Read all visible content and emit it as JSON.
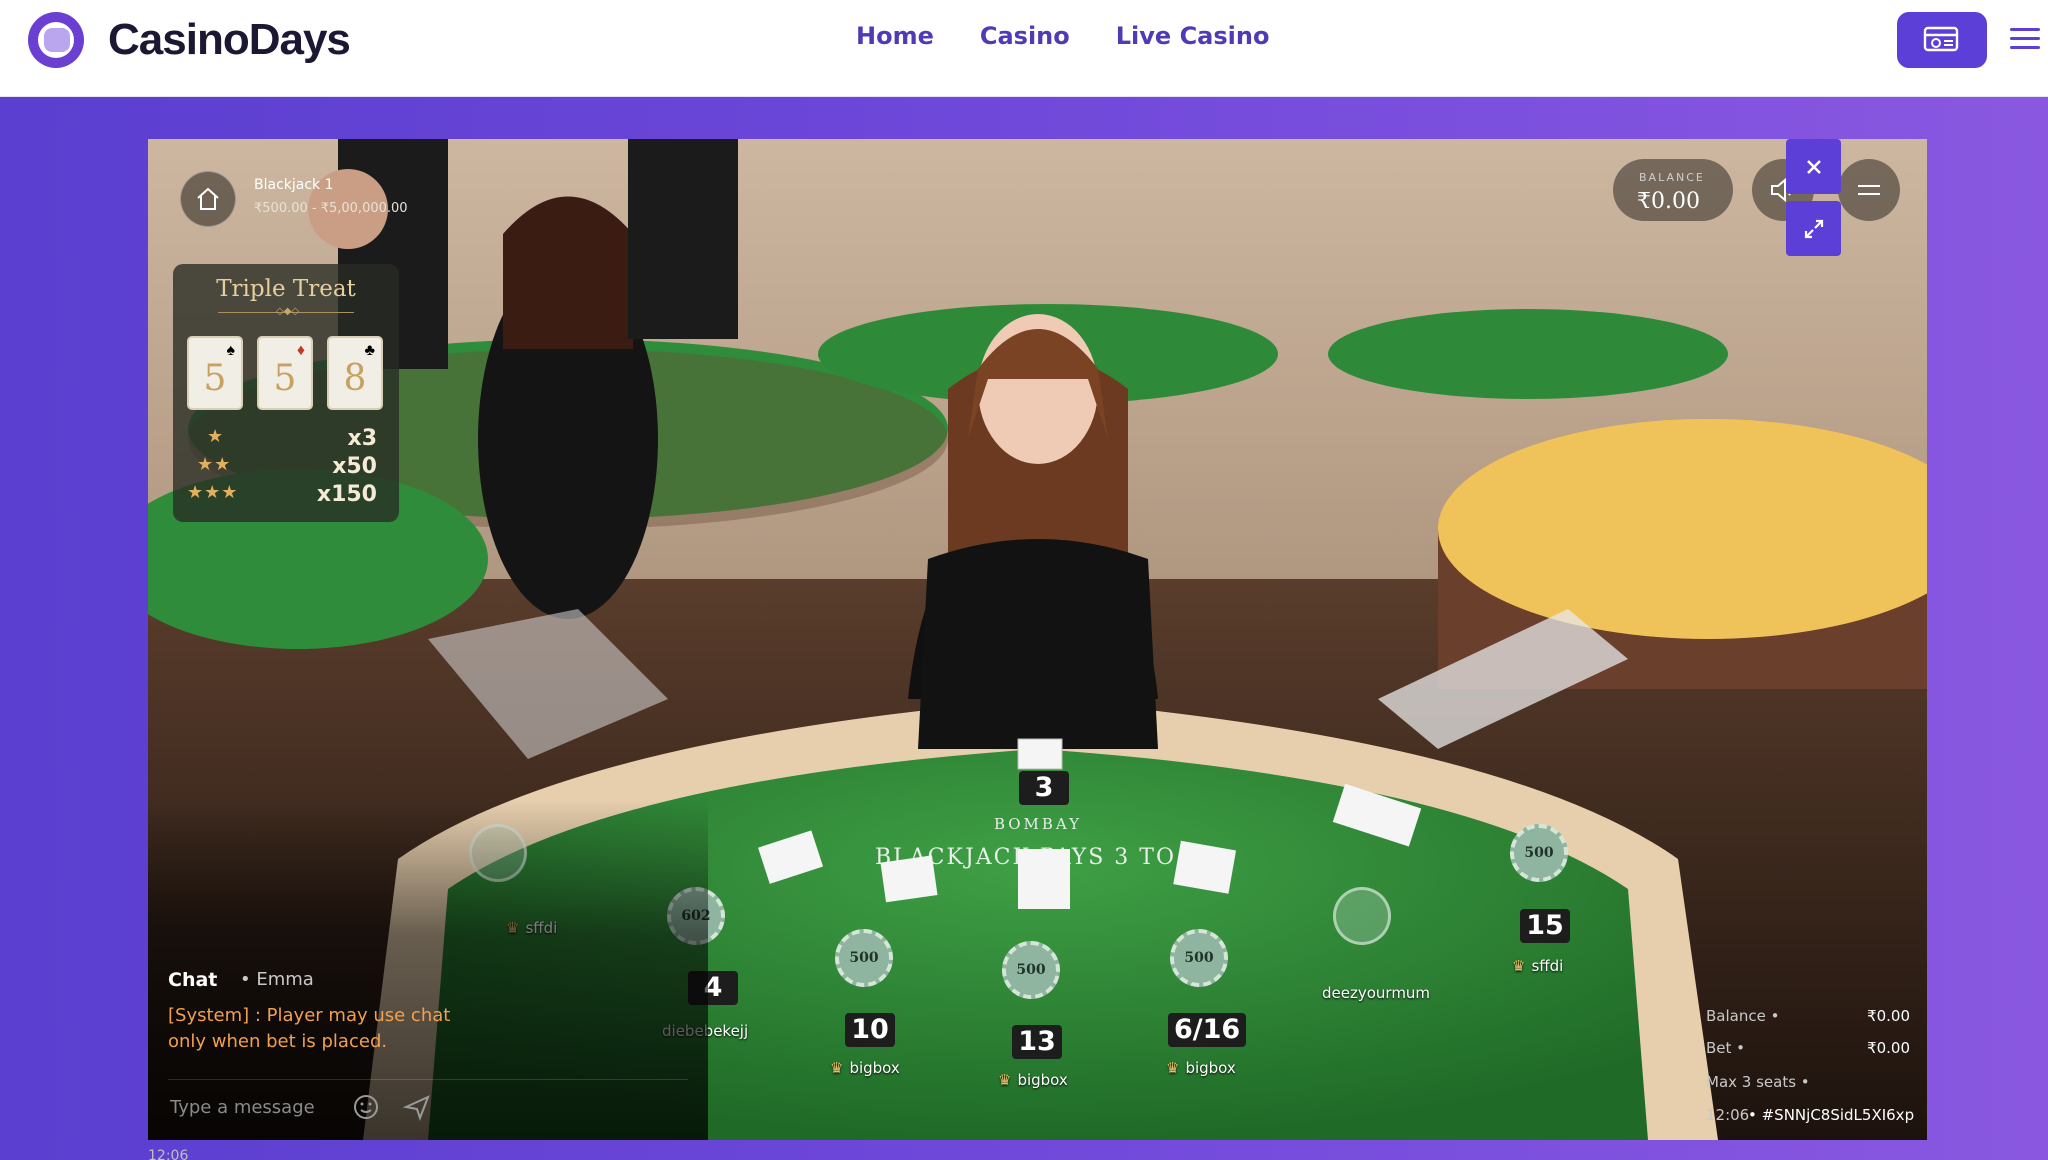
{
  "header": {
    "logo_text": "CasinoDays",
    "nav": [
      "Home",
      "Casino",
      "Live Casino"
    ],
    "cashier_icon": "cashier-icon",
    "menu_icon": "hamburger-menu-icon"
  },
  "game": {
    "table_name": "Blackjack 1",
    "table_limits": "₹500.00 - ₹5,00,000.00",
    "triple_treat": {
      "title": "Triple Treat",
      "cards": [
        {
          "rank": "5",
          "suit": "♠",
          "color": "#111111"
        },
        {
          "rank": "5",
          "suit": "♦",
          "color": "#c0392b"
        },
        {
          "rank": "8",
          "suit": "♣",
          "color": "#111111"
        }
      ],
      "payouts": [
        {
          "stars": "★",
          "mult": "x3"
        },
        {
          "stars": "★★",
          "mult": "x50"
        },
        {
          "stars": "★★★",
          "mult": "x150"
        }
      ]
    },
    "balance": {
      "label": "BALANCE",
      "value": "₹0.00"
    },
    "dealer_total": "3",
    "seats": [
      {
        "name": "sffdi",
        "chip": "",
        "total": ""
      },
      {
        "name": "diebebekejj",
        "chip": "602",
        "total": "4"
      },
      {
        "name": "bigbox",
        "chip": "500",
        "total": "10"
      },
      {
        "name": "bigbox",
        "chip": "500",
        "total": "13"
      },
      {
        "name": "bigbox",
        "chip": "500",
        "total": "6/16"
      },
      {
        "name": "deezyourmum",
        "chip": "",
        "total": ""
      },
      {
        "name": "sffdi",
        "chip": "500",
        "total": "15"
      }
    ],
    "chat": {
      "title": "Chat",
      "user": "• Emma",
      "message": "[System] : Player may use chat only when bet is placed.",
      "placeholder": "Type a message"
    },
    "stats": {
      "balance_label": "Balance •",
      "balance_value": "₹0.00",
      "bet_label": "Bet •",
      "bet_value": "₹0.00",
      "max_seats": "Max 3 seats •",
      "time": "12:06",
      "round_id": "• #SNNjC8SidL5XI6xp"
    }
  },
  "below_time": "12:06"
}
